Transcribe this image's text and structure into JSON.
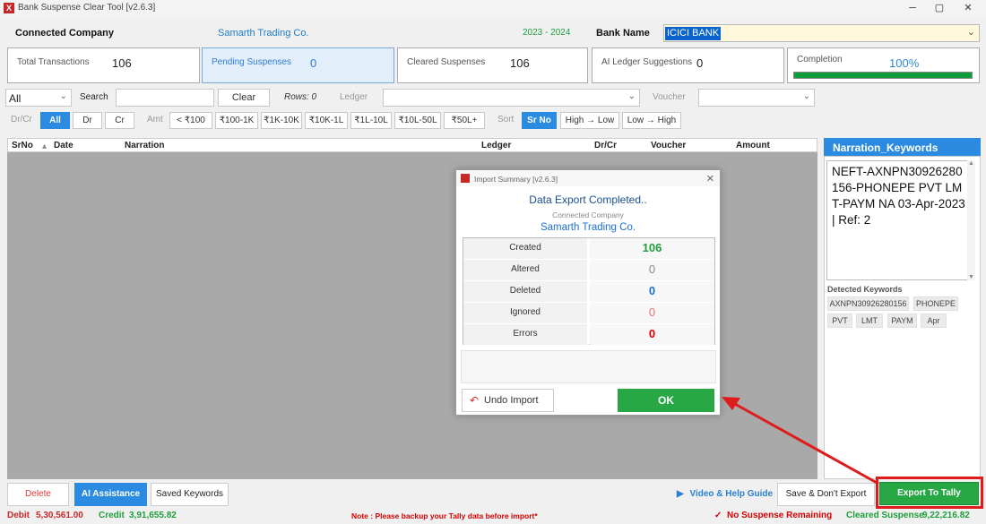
{
  "window": {
    "title": "Bank Suspense Clear Tool [v2.6.3]",
    "logo_glyph": "X",
    "minimize_glyph": "─",
    "restore_glyph": "▢",
    "close_glyph": "✕"
  },
  "header": {
    "connected_company_label": "Connected Company",
    "company_name": "Samarth Trading Co.",
    "financial_year": "2023 - 2024",
    "bank_name_label": "Bank Name",
    "bank_name_value": "ICICI BANK",
    "dropdown_glyph": "⌄"
  },
  "stats": {
    "total_transactions": {
      "label": "Total Transactions",
      "value": "106"
    },
    "pending_suspenses": {
      "label": "Pending Suspenses",
      "value": "0"
    },
    "cleared_suspenses": {
      "label": "Cleared Suspenses",
      "value": "106"
    },
    "ai_ledger_suggestions": {
      "label": "AI Ledger Suggestions",
      "value": "0"
    },
    "completion": {
      "label": "Completion",
      "value": "100%",
      "fraction": 1.0
    }
  },
  "filters": {
    "all_select_value": "All",
    "search_label": "Search",
    "search_value": "",
    "clear_label": "Clear",
    "rows_label": "Rows: 0",
    "ledger_label": "Ledger",
    "ledger_value": "",
    "voucher_label": "Voucher",
    "voucher_value": "",
    "drcr_label": "Dr/Cr",
    "drcr_buttons": [
      "All",
      "Dr",
      "Cr"
    ],
    "amt_label": "Amt",
    "amt_buttons": [
      "< ₹100",
      "₹100-1K",
      "₹1K-10K",
      "₹10K-1L",
      "₹1L-10L",
      "₹10L-50L",
      "₹50L+"
    ],
    "sort_label": "Sort",
    "sort_buttons": [
      "Sr No",
      "High → Low",
      "Low → High"
    ]
  },
  "grid": {
    "columns": [
      "SrNo",
      "Date",
      "Narration",
      "Ledger",
      "Dr/Cr",
      "Voucher",
      "Amount"
    ],
    "sort_indicator": "▴"
  },
  "right_panel": {
    "title": "Narration_Keywords",
    "narration_text": "NEFT-AXNPN30926280156-PHONEPE PVT LMT-PAYM NA 03-Apr-2023 | Ref: 2",
    "detected_label": "Detected Keywords",
    "keywords": [
      "AXNPN30926280156",
      "PHONEPE",
      "PVT",
      "LMT",
      "PAYM",
      "Apr"
    ]
  },
  "dialog": {
    "title": "Import Summary [v2.6.3]",
    "heading": "Data Export Completed..",
    "connected_company_label": "Connected Company",
    "company_name": "Samarth Trading Co.",
    "rows": [
      {
        "label": "Created",
        "value": "106",
        "color": "#1e9e3a"
      },
      {
        "label": "Altered",
        "value": "0",
        "color": "#888888"
      },
      {
        "label": "Deleted",
        "value": "0",
        "color": "#1e6fd0"
      },
      {
        "label": "Ignored",
        "value": "0",
        "color": "#e57373"
      },
      {
        "label": "Errors",
        "value": "0",
        "color": "#d50000"
      }
    ],
    "undo_label": "Undo Import",
    "undo_icon": "↶",
    "ok_label": "OK",
    "close_glyph": "✕"
  },
  "bottom": {
    "delete_label": "Delete",
    "ai_assistance_label": "AI Assistance",
    "saved_keywords_label": "Saved Keywords",
    "video_help_label": "Video & Help Guide",
    "video_icon": "▶",
    "save_dont_export_label": "Save & Don't Export",
    "export_label": "Export To Tally"
  },
  "status": {
    "debit_label": "Debit",
    "debit_value": "5,30,561.00",
    "credit_label": "Credit",
    "credit_value": "3,91,655.82",
    "note": "Note : Please backup your Tally data before import*",
    "no_suspense_icon": "✓",
    "no_suspense": "No Suspense Remaining",
    "cleared_label": "Cleared Suspense",
    "cleared_value": "9,22,216.82"
  },
  "colors": {
    "accent_blue": "#2a8be0",
    "success_green": "#28a745",
    "annotation_red": "#e01b1b"
  }
}
